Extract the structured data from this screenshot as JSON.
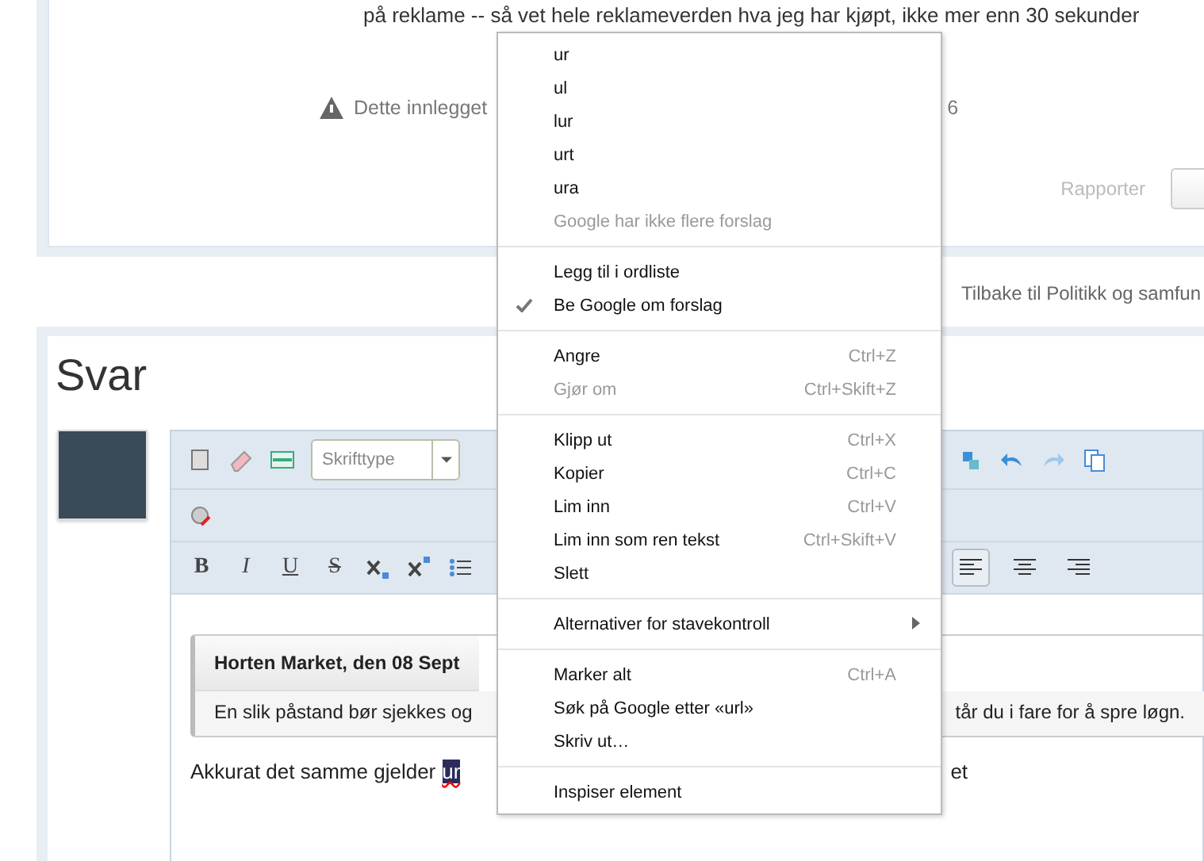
{
  "post": {
    "text_line": "på reklame -- så vet hele reklameverden hva jeg har kjøpt, ikke mer enn 30 sekunder",
    "notice_start": "Dette innlegget",
    "notice_end": "6",
    "report_link": "Rapporter"
  },
  "back_link": "Tilbake til Politikk og samfun",
  "reply": {
    "title": "Svar",
    "toolbar": {
      "font_select": {
        "placeholder": "Skrifttype"
      },
      "format_buttons": [
        "B",
        "I",
        "U",
        "S"
      ],
      "align_buttons": [
        {
          "selected": true
        },
        {
          "selected": false
        },
        {
          "selected": false
        }
      ]
    },
    "quote": {
      "title": "Horten Market, den 08 Sept",
      "body_start": "En slik påstand bør sjekkes og",
      "body_end": "tår du i fare for å spre løgn."
    },
    "body": {
      "before": "Akkurat det samme gjelder",
      "selected": "ur",
      "after": "et"
    }
  },
  "context_menu": {
    "groups": [
      [
        {
          "label": "ur"
        },
        {
          "label": "ul"
        },
        {
          "label": "lur"
        },
        {
          "label": "urt"
        },
        {
          "label": "ura"
        },
        {
          "label": "Google har ikke flere forslag",
          "disabled": true
        }
      ],
      [
        {
          "label": "Legg til i ordliste",
          "checked": false
        },
        {
          "label": "Be Google om forslag",
          "checked": true
        }
      ],
      [
        {
          "label": "Angre",
          "shortcut": "Ctrl+Z",
          "disabled": false
        },
        {
          "label": "Gjør om",
          "shortcut": "Ctrl+Skift+Z",
          "disabled": true
        }
      ],
      [
        {
          "label": "Klipp ut",
          "shortcut": "Ctrl+X"
        },
        {
          "label": "Kopier",
          "shortcut": "Ctrl+C"
        },
        {
          "label": "Lim inn",
          "shortcut": "Ctrl+V"
        },
        {
          "label": "Lim inn som ren tekst",
          "shortcut": "Ctrl+Skift+V"
        },
        {
          "label": "Slett"
        }
      ],
      [
        {
          "label": "Alternativer for stavekontroll",
          "submenu": true
        }
      ],
      [
        {
          "label": "Marker alt",
          "shortcut": "Ctrl+A"
        },
        {
          "label": "Søk på Google etter «url»"
        },
        {
          "label": "Skriv ut…"
        }
      ],
      [
        {
          "label": "Inspiser element"
        }
      ]
    ]
  }
}
